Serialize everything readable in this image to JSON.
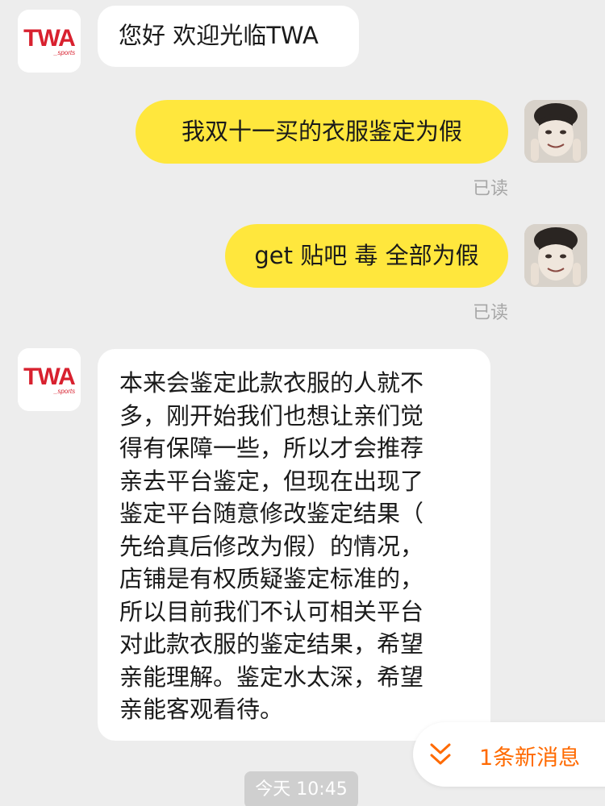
{
  "messages": [
    {
      "sender": "shop",
      "text": "您好 欢迎光临TWA"
    },
    {
      "sender": "user",
      "text": "我双十一买的衣服鉴定为假",
      "status": "已读"
    },
    {
      "sender": "user",
      "text": "get 贴吧 毒 全部为假",
      "status": "已读"
    },
    {
      "sender": "shop",
      "lines": [
        "本来会鉴定此款衣服的人就不",
        "多，刚开始我们也想让亲们觉",
        "得有保障一些，所以才会推荐",
        "亲去平台鉴定，但现在出现了",
        "鉴定平台随意修改鉴定结果（",
        "先给真后修改为假）的情况，",
        "店铺是有权质疑鉴定标准的，",
        "所以目前我们不认可相关平台",
        "对此款衣服的鉴定结果，希望",
        "亲能理解。鉴定水太深，希望",
        "亲能客观看待。"
      ]
    }
  ],
  "shop_logo": {
    "text": "TWA",
    "sub": "_sports",
    "color": "#d8212f"
  },
  "new_message": {
    "label": "1条新消息",
    "icon": "double-chevron-down-icon",
    "color": "#ff6a00"
  },
  "timestamp": "今天 10:45",
  "colors": {
    "background": "#ededed",
    "user_bubble": "#ffe73d",
    "shop_bubble": "#ffffff"
  }
}
